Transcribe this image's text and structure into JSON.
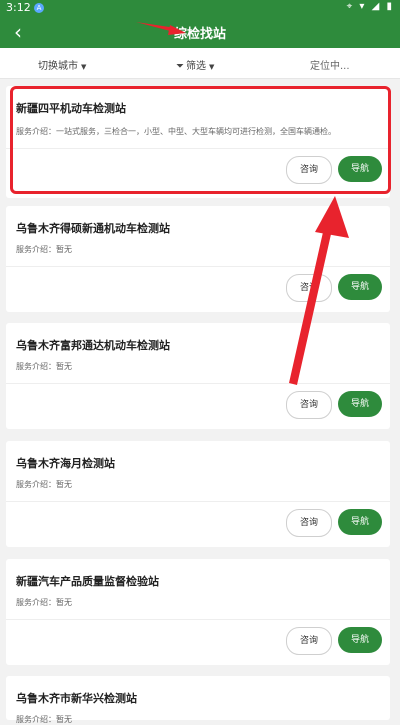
{
  "status_bar": {
    "time": "3:12",
    "notification_badge": "A",
    "right_icons": "location-wifi-signal-battery"
  },
  "header": {
    "title": "综检找站"
  },
  "filters": {
    "city": "切换城市",
    "screen": "筛选",
    "location": "定位中..."
  },
  "cards": [
    {
      "name": "新疆四平机动车检测站",
      "service": "服务介绍：一站式服务，三检合一，小型、中型、大型车辆均可进行检测，全国车辆通检。",
      "consult": "咨询",
      "navigate": "导航"
    },
    {
      "name": "乌鲁木齐得硕新通机动车检测站",
      "service": "服务介绍：暂无",
      "consult": "咨询",
      "navigate": "导航"
    },
    {
      "name": "乌鲁木齐富邦通达机动车检测站",
      "service": "服务介绍：暂无",
      "consult": "咨询",
      "navigate": "导航"
    },
    {
      "name": "乌鲁木齐海月检测站",
      "service": "服务介绍：暂无",
      "consult": "咨询",
      "navigate": "导航"
    },
    {
      "name": "新疆汽车产品质量监督检验站",
      "service": "服务介绍：暂无",
      "consult": "咨询",
      "navigate": "导航"
    },
    {
      "name": "乌鲁木齐市新华兴检测站",
      "service": "服务介绍：暂无"
    }
  ],
  "colors": {
    "primary": "#2e8b3c",
    "annotation": "#e8232d"
  }
}
